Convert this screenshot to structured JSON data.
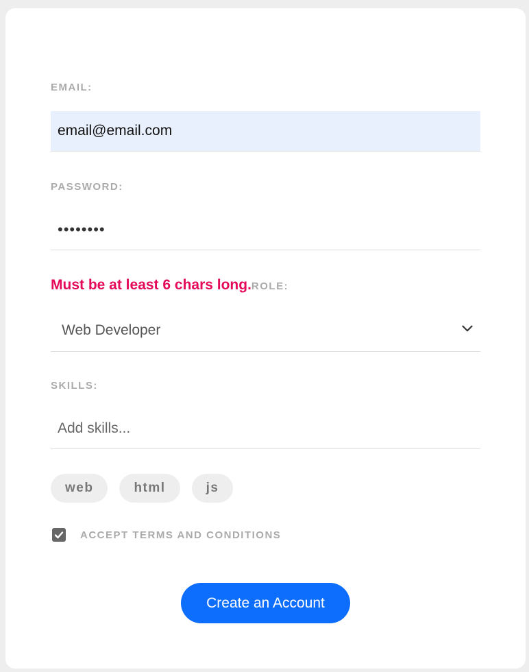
{
  "form": {
    "email_label": "EMAIL:",
    "email_value": "email@email.com",
    "password_label": "PASSWORD:",
    "password_value": "••••••••",
    "password_error": "Must be at least 6 chars long.",
    "role_label": "ROLE:",
    "role_selected": "Web Developer",
    "skills_label": "SKILLS:",
    "skills_placeholder": "Add skills...",
    "skills": [
      "web",
      "html",
      "js"
    ],
    "terms_label": "ACCEPT TERMS AND CONDITIONS",
    "terms_checked": true,
    "submit_label": "Create an Account"
  },
  "icons": {
    "dropdown": "chevron-down-icon",
    "checkbox": "checkmark-icon"
  },
  "colors": {
    "accent": "#0d6efd",
    "error": "#e5095a",
    "label": "#aaaaaa",
    "autofill": "#e8f0fe"
  }
}
